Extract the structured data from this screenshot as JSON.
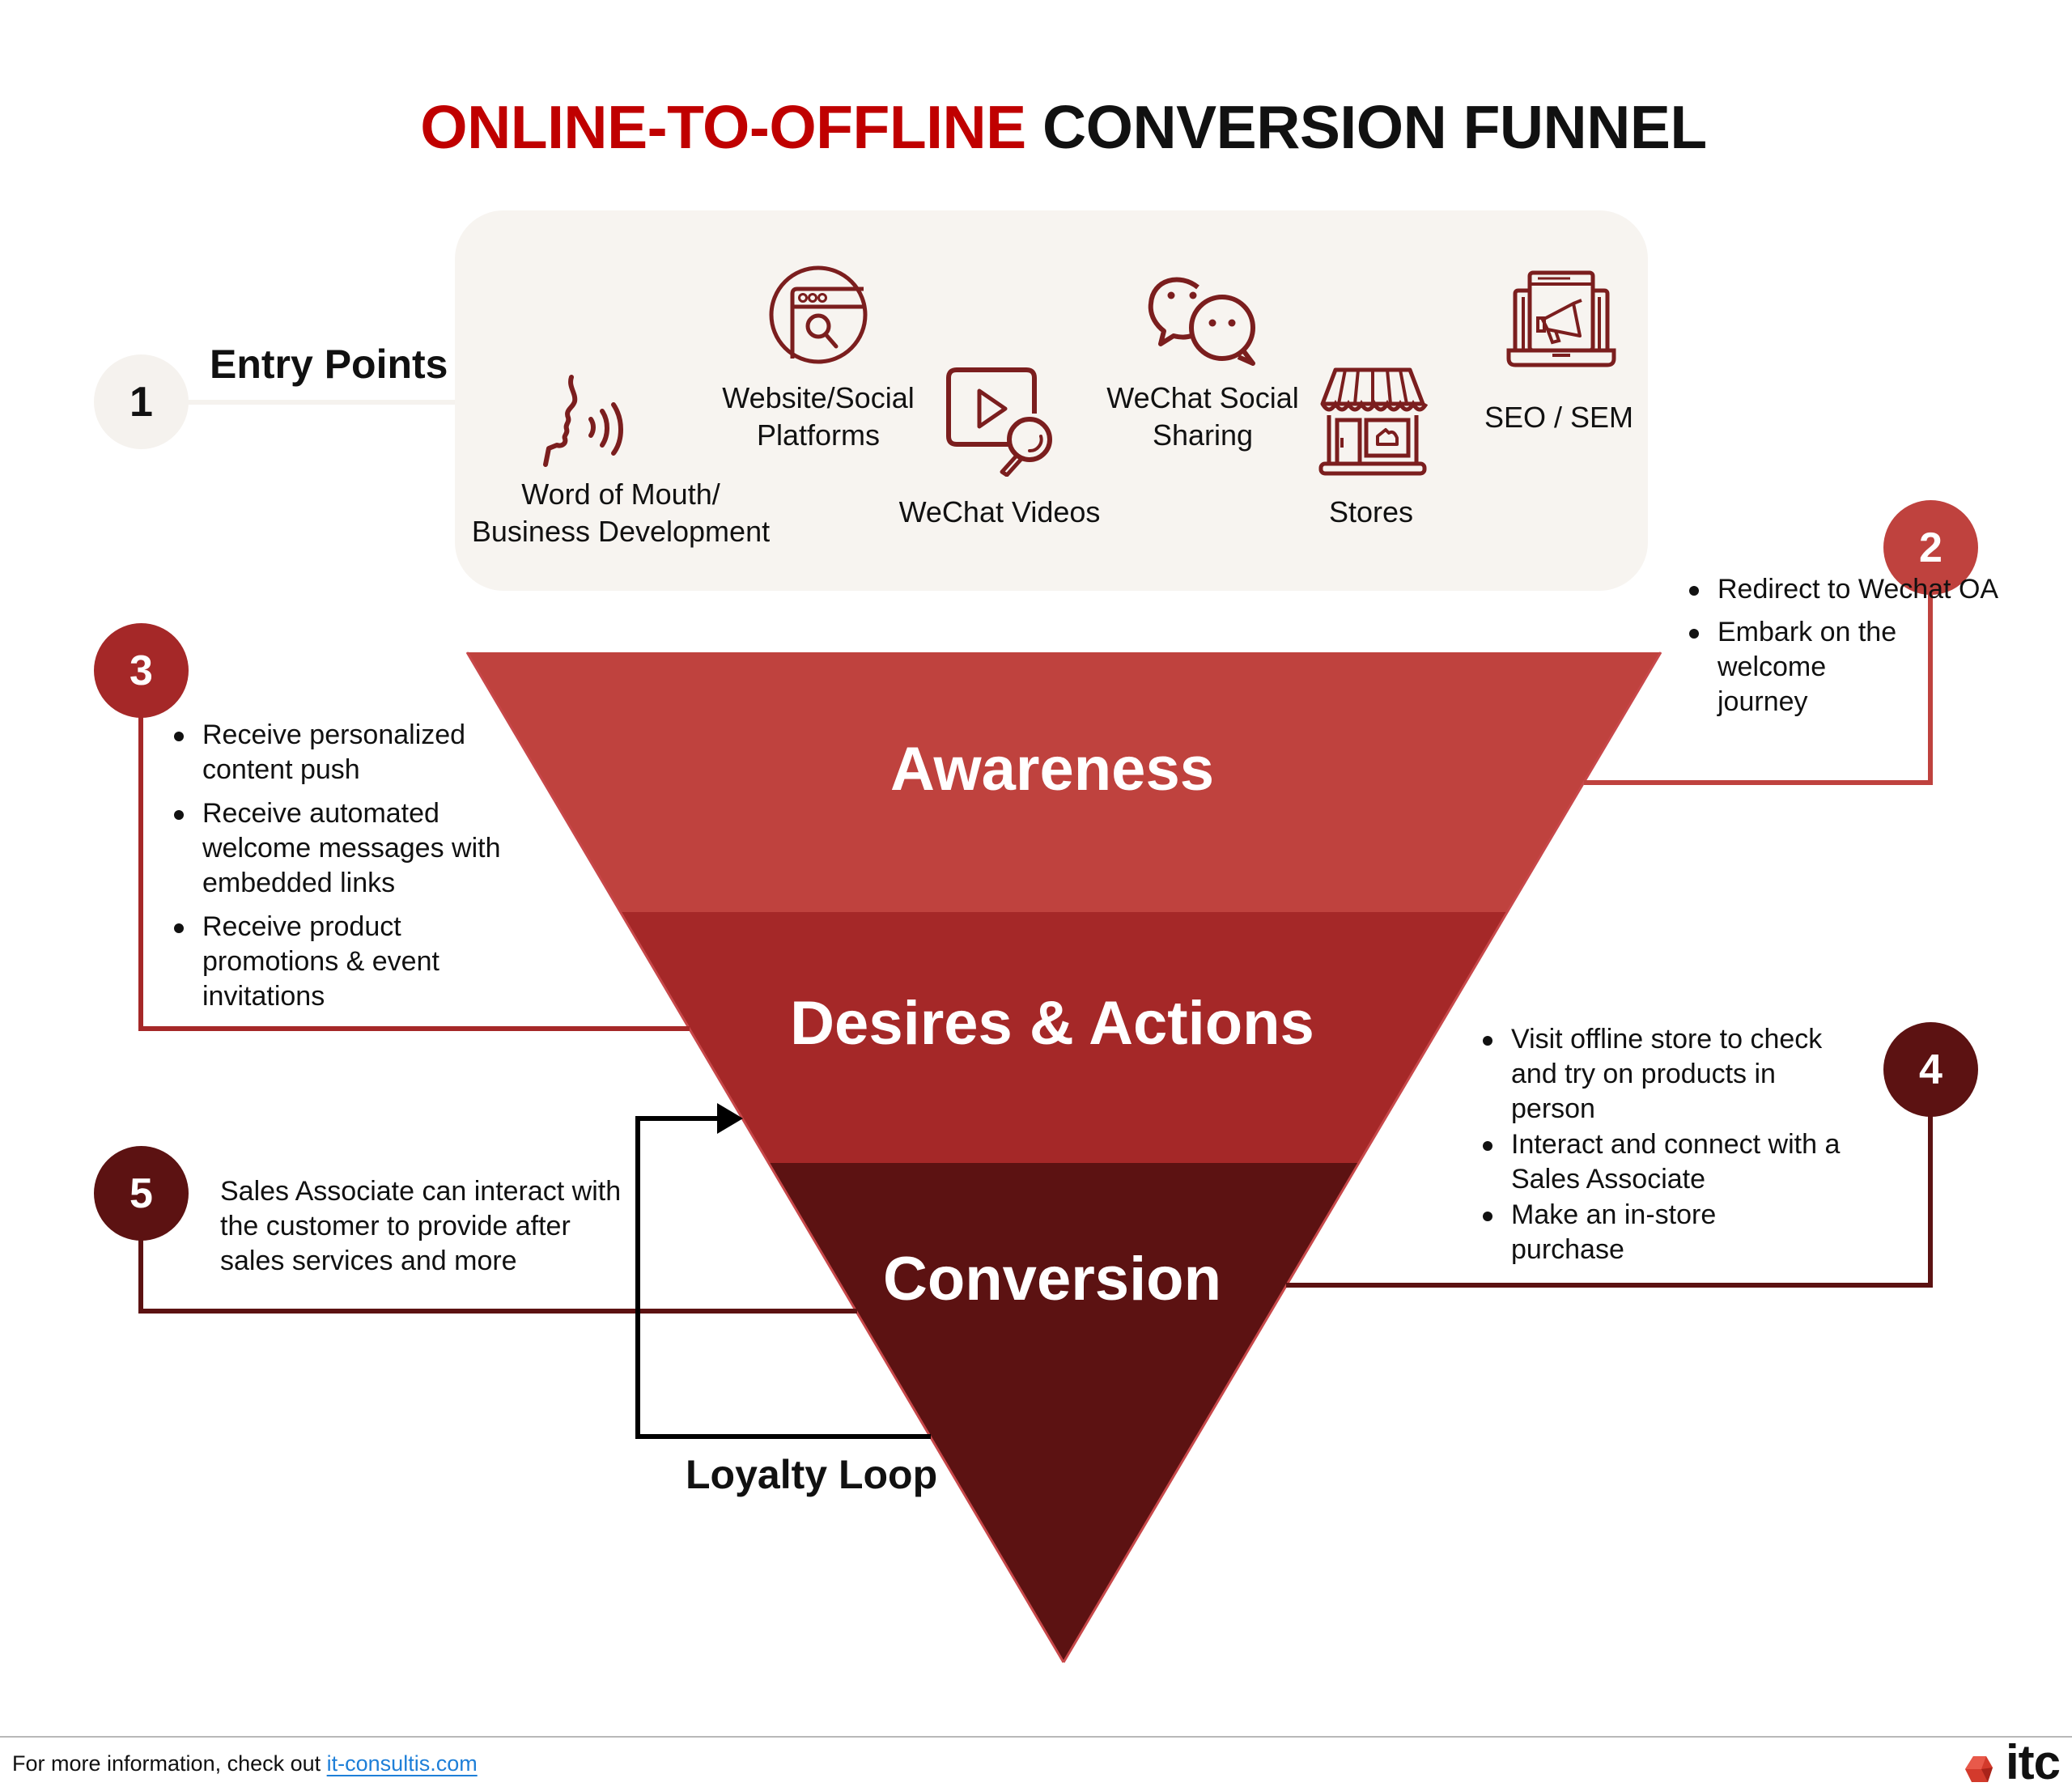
{
  "title": {
    "highlight": "ONLINE-TO-OFFLINE",
    "rest": "CONVERSION FUNNEL"
  },
  "colors": {
    "title_red": "#C00000",
    "awareness": "#BF423E",
    "desires": "#A52828",
    "conversion": "#5C1212",
    "icon": "#7B1E1E",
    "entry_box": "#F7F4F0",
    "link": "#1E7FD8"
  },
  "entry": {
    "step_number": "1",
    "heading": "Entry Points",
    "items": [
      {
        "label_lines": [
          "Word of Mouth/",
          "Business Development"
        ],
        "icon": "speaking-face-icon"
      },
      {
        "label_lines": [
          "Website/Social",
          "Platforms"
        ],
        "icon": "browser-search-icon"
      },
      {
        "label_lines": [
          "WeChat Videos"
        ],
        "icon": "video-search-icon"
      },
      {
        "label_lines": [
          "WeChat Social",
          "Sharing"
        ],
        "icon": "wechat-icon"
      },
      {
        "label_lines": [
          "Stores"
        ],
        "icon": "storefront-icon"
      },
      {
        "label_lines": [
          "SEO / SEM"
        ],
        "icon": "laptop-megaphone-icon"
      }
    ]
  },
  "funnel": {
    "stages": [
      {
        "label": "Awareness"
      },
      {
        "label": "Desires & Actions"
      },
      {
        "label": "Conversion"
      }
    ]
  },
  "steps": [
    {
      "number": "2",
      "items": [
        "Redirect to Wechat OA",
        "Embark on the welcome journey"
      ]
    },
    {
      "number": "3",
      "items": [
        "Receive personalized content push",
        "Receive automated welcome messages with embedded links",
        "Receive product promotions & event invitations"
      ]
    },
    {
      "number": "4",
      "items": [
        "Visit offline store to check and try on products in person",
        "Interact and connect with a Sales Associate",
        "Make an in-store purchase"
      ]
    },
    {
      "number": "5",
      "text": "Sales Associate can interact with the customer to provide after sales services and more"
    }
  ],
  "loyalty_loop": {
    "label": "Loyalty Loop"
  },
  "footer": {
    "text": "For more information, check out ",
    "link_text": "it-consultis.com",
    "logo_text": "itc"
  }
}
